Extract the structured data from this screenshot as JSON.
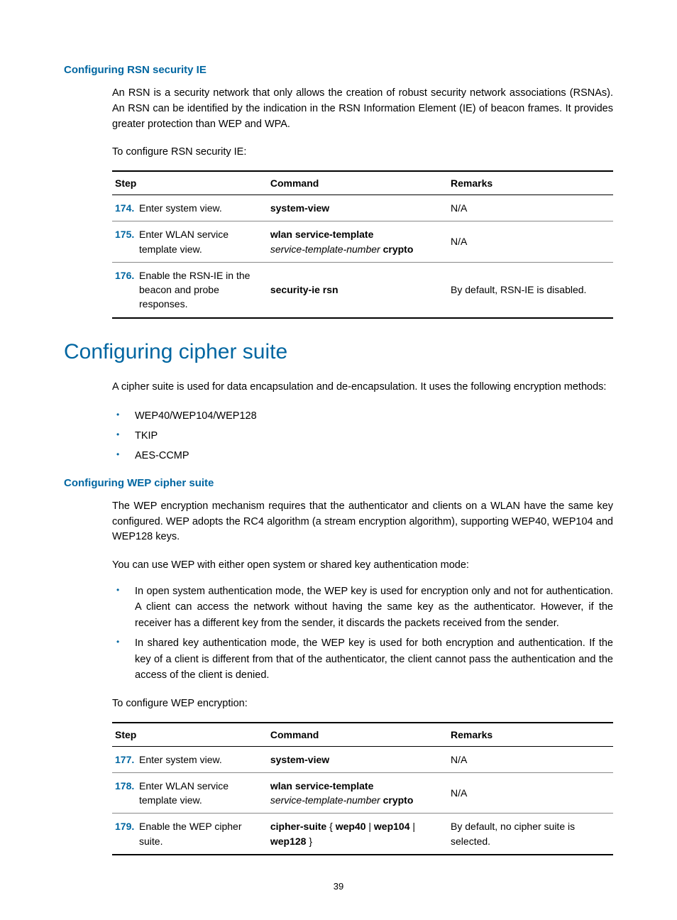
{
  "section1": {
    "heading": "Configuring RSN security IE",
    "para": "An RSN is a security network that only allows the creation of robust security network associations (RSNAs). An RSN can be identified by the indication in the RSN Information Element (IE) of beacon frames. It provides greater protection than WEP and WPA.",
    "lead": "To configure RSN security IE:",
    "headers": {
      "c1": "Step",
      "c2": "Command",
      "c3": "Remarks"
    },
    "rows": [
      {
        "num": "174.",
        "step": "Enter system view.",
        "cmd_bold": "system-view",
        "cmd_after": "",
        "remark": "N/A"
      },
      {
        "num": "175.",
        "step": "Enter WLAN service template view.",
        "cmd_bold": "wlan service-template",
        "cmd_after": "service-template-number",
        "cmd_tail_bold": "crypto",
        "remark": "N/A"
      },
      {
        "num": "176.",
        "step": "Enable the RSN-IE in the beacon and probe responses.",
        "cmd_bold": "security-ie rsn",
        "cmd_after": "",
        "remark": "By default, RSN-IE is disabled."
      }
    ]
  },
  "section2": {
    "heading": "Configuring cipher suite",
    "para1": "A cipher suite is used for data encapsulation and de-encapsulation. It uses the following encryption methods:",
    "bullets1": [
      "WEP40/WEP104/WEP128",
      "TKIP",
      "AES-CCMP"
    ]
  },
  "section3": {
    "heading": "Configuring WEP cipher suite",
    "para1": "The WEP encryption mechanism requires that the authenticator and clients on a WLAN have the same key configured. WEP adopts the RC4 algorithm (a stream encryption algorithm), supporting WEP40, WEP104 and WEP128 keys.",
    "para2": "You can use WEP with either open system or shared key authentication mode:",
    "bullets": [
      "In open system authentication mode, the WEP key is used for encryption only and not for authentication. A client can access the network without having the same key as the authenticator. However, if the receiver has a different key from the sender, it discards the packets received from the sender.",
      "In shared key authentication mode, the WEP key is used for both encryption and authentication. If the key of a client is different from that of the authenticator, the client cannot pass the authentication and the access of the client is denied."
    ],
    "lead": "To configure WEP encryption:",
    "headers": {
      "c1": "Step",
      "c2": "Command",
      "c3": "Remarks"
    },
    "rows": [
      {
        "num": "177.",
        "step": "Enter system view.",
        "cmd_html": "<span class='cmd-bold'>system-view</span>",
        "remark": "N/A"
      },
      {
        "num": "178.",
        "step": "Enter WLAN service template view.",
        "cmd_html": "<span class='cmd-bold'>wlan service-template</span><br><span class='cmd-italic'>service-template-number</span> <span class='cmd-bold'>crypto</span>",
        "remark": "N/A"
      },
      {
        "num": "179.",
        "step": "Enable the WEP cipher suite.",
        "cmd_html": "<span class='cmd-bold'>cipher-suite</span> { <span class='cmd-bold'>wep40</span> | <span class='cmd-bold'>wep104</span> | <span class='cmd-bold'>wep128</span> }",
        "remark": "By default, no cipher suite is selected."
      }
    ]
  },
  "page_number": "39"
}
